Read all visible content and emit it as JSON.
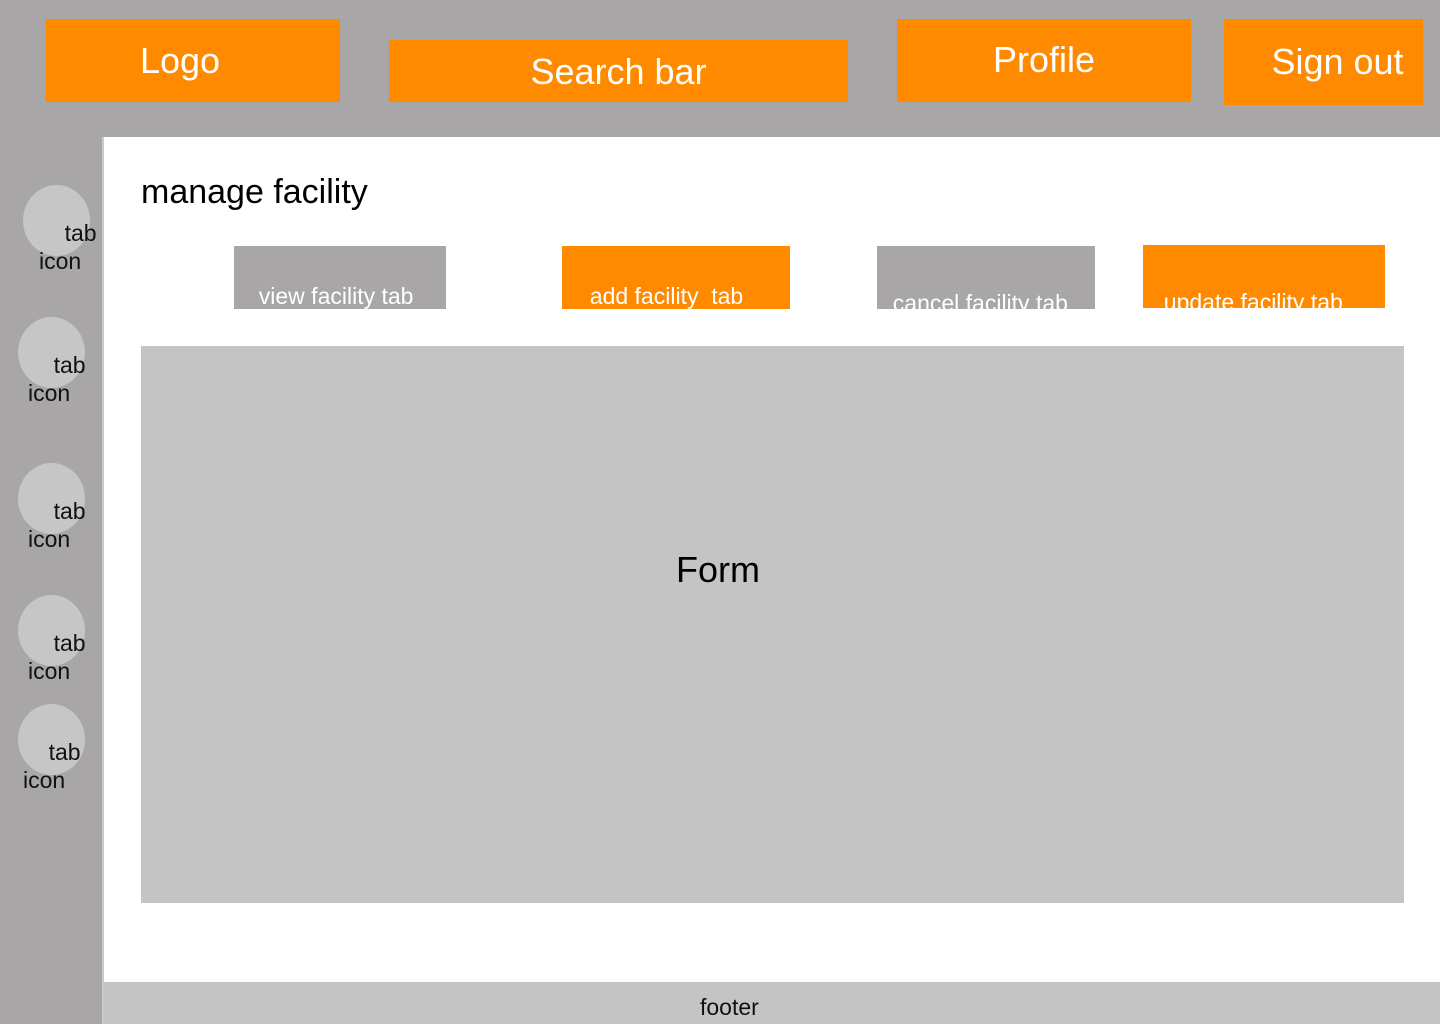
{
  "header": {
    "logo_label": "Logo",
    "search_label": "Search bar",
    "profile_label": "Profile",
    "signout_label": "Sign out"
  },
  "sidebar": {
    "items": [
      {
        "label": "tab\nicon"
      },
      {
        "label": "tab\nicon"
      },
      {
        "label": "tab\nicon"
      },
      {
        "label": "tab\nicon"
      },
      {
        "label": "tab\nicon"
      }
    ]
  },
  "main": {
    "title": "manage facility",
    "tabs": [
      {
        "label": "view facility tab"
      },
      {
        "label": "add facility  tab"
      },
      {
        "label": "cancel facility tab"
      },
      {
        "label": "update facility tab"
      }
    ],
    "form_label": "Form"
  },
  "footer": {
    "label": "footer"
  },
  "colors": {
    "accent": "#ff8a00",
    "chrome_gray": "#a8a6a7",
    "placeholder_gray": "#c4c4c4"
  }
}
